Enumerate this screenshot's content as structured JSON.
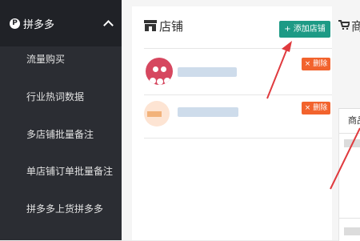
{
  "sidebar": {
    "header_label": "拼多多",
    "items": [
      {
        "label": "流量购买"
      },
      {
        "label": "行业热词数据"
      },
      {
        "label": "多店铺批量备注"
      },
      {
        "label": "单店铺订单批量备注"
      },
      {
        "label": "拼多多上货拼多多"
      }
    ]
  },
  "shop_panel": {
    "title": "店铺",
    "add_button": "+ 添加店铺",
    "delete_button": "× 删除"
  },
  "product_panel": {
    "title": "商",
    "column_header": "商品"
  },
  "colors": {
    "sidebar_bg": "#2b2d33",
    "accent_green": "#1d9a85",
    "delete_orange": "#f2632d",
    "arrow_red": "#e03a3e"
  }
}
